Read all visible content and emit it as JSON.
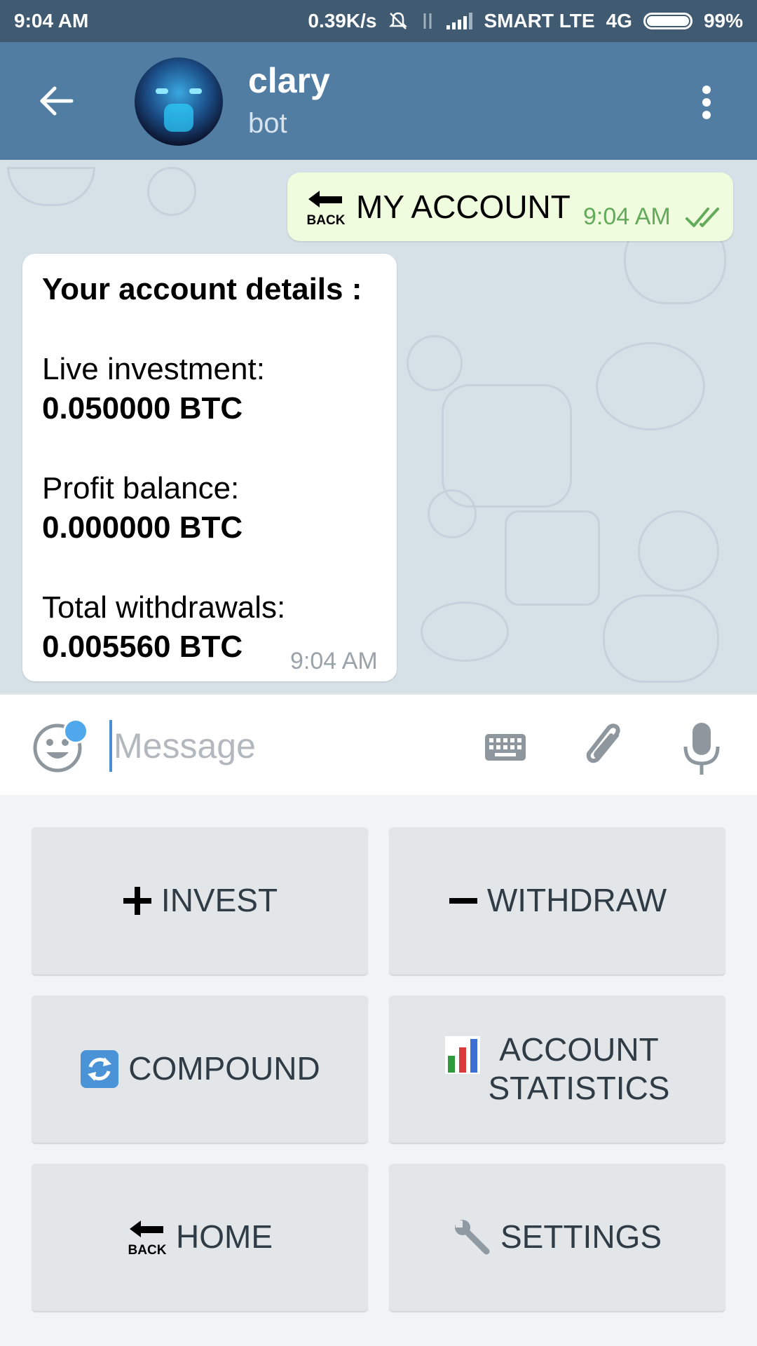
{
  "status_bar": {
    "time": "9:04 AM",
    "speed": "0.39K/s",
    "carrier": "SMART LTE",
    "network": "4G",
    "battery": "99%"
  },
  "header": {
    "name": "clary",
    "status": "bot"
  },
  "messages": {
    "outgoing": {
      "icon": "back-arrow-emoji",
      "icon_text": "BACK",
      "text": "MY ACCOUNT",
      "time": "9:04 AM"
    },
    "incoming": {
      "title": "Your account details :",
      "live_label": "Live investment:",
      "live_value": "0.050000 BTC",
      "profit_label": "Profit balance:",
      "profit_value": "0.000000 BTC",
      "withdraw_label": "Total withdrawals:",
      "withdraw_value": "0.005560 BTC",
      "time": "9:04 AM"
    }
  },
  "input": {
    "placeholder": "Message"
  },
  "keyboard": {
    "invest": "INVEST",
    "withdraw": "WITHDRAW",
    "compound": "COMPOUND",
    "account_stats_line1": "ACCOUNT",
    "account_stats_line2": "STATISTICS",
    "home_icon_text": "BACK",
    "home": "HOME",
    "settings": "SETTINGS"
  },
  "colors": {
    "header": "#527da3",
    "status_bar": "#3f5a71",
    "outgoing_bubble": "#effdde",
    "accent_green": "#63aa5a",
    "key_bg": "#e2e6e9"
  }
}
